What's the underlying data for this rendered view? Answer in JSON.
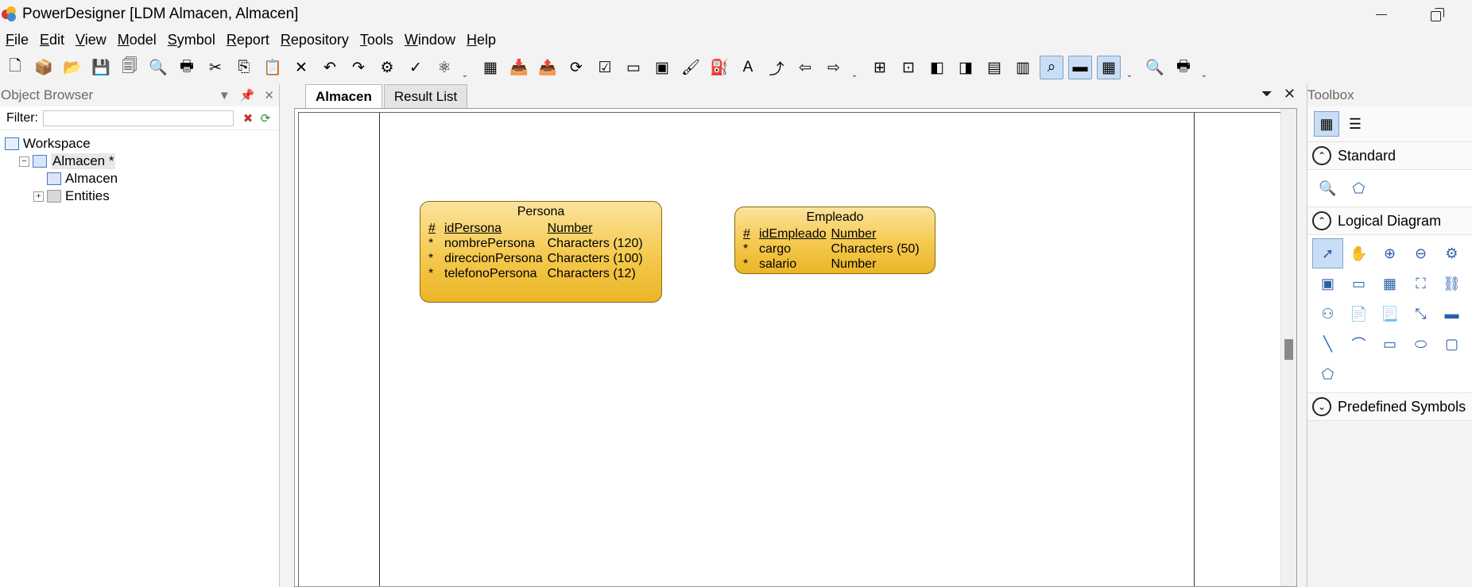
{
  "window": {
    "title": "PowerDesigner [LDM Almacen, Almacen]",
    "minimize": "—",
    "maximize": "❐"
  },
  "menu": [
    {
      "label": "File",
      "key": "F",
      "rest": "ile"
    },
    {
      "label": "Edit",
      "key": "E",
      "rest": "dit"
    },
    {
      "label": "View",
      "key": "V",
      "rest": "iew"
    },
    {
      "label": "Model",
      "key": "M",
      "rest": "odel"
    },
    {
      "label": "Symbol",
      "key": "S",
      "rest": "ymbol"
    },
    {
      "label": "Report",
      "key": "R",
      "rest": "eport"
    },
    {
      "label": "Repository",
      "key": "R",
      "rest": "epository"
    },
    {
      "label": "Tools",
      "key": "T",
      "rest": "ools"
    },
    {
      "label": "Window",
      "key": "W",
      "rest": "indow"
    },
    {
      "label": "Help",
      "key": "H",
      "rest": "elp"
    }
  ],
  "toolbar": {
    "icons": [
      "new-icon",
      "new-project-icon",
      "open-icon",
      "save-icon",
      "save-all-icon",
      "print-preview-icon",
      "print-icon",
      "cut-icon",
      "copy-icon",
      "paste-icon",
      "delete-icon",
      "undo-icon",
      "redo-icon",
      "properties-icon",
      "spell-check-icon",
      "impact-analysis-icon"
    ],
    "icons2": [
      "check-model-icon",
      "import-icon",
      "export-icon",
      "refresh-icon",
      "checklist-icon",
      "shadow-icon",
      "frame-icon",
      "paint-icon",
      "fill-icon",
      "text-color-icon",
      "move-icon",
      "back-icon",
      "forward-icon"
    ],
    "icons3": [
      "align-left-icon",
      "align-center-icon",
      "align-right-icon",
      "distribute-icon",
      "group-icon",
      "ungroup-icon",
      "find-icon",
      "display-icon",
      "grid-icon"
    ],
    "icons4": [
      "zoom-page-icon",
      "print-setup-icon"
    ],
    "glyphs": [
      "🗋",
      "📦",
      "📂",
      "💾",
      "🗐",
      "🔍",
      "🖶",
      "✂",
      "⎘",
      "📋",
      "✕",
      "↶",
      "↷",
      "⚙",
      "✓",
      "⚛"
    ],
    "glyphs2": [
      "▦",
      "📥",
      "📤",
      "⟳",
      "☑",
      "▭",
      "▣",
      "🖌",
      "⛽",
      "A",
      "⤴",
      "⇦",
      "⇨"
    ],
    "glyphs3": [
      "⊞",
      "⊡",
      "◧",
      "◨",
      "▤",
      "▥",
      "⌕",
      "▬",
      "▦"
    ],
    "glyphs4": [
      "🔍",
      "🖶"
    ],
    "more": "⌄"
  },
  "object_browser": {
    "title": "Object Browser",
    "controls": [
      "▼",
      "📌",
      "✕"
    ],
    "filter_label": "Filter:",
    "filter_value": "",
    "filter_icons": [
      "✖",
      "⟳"
    ],
    "tree": [
      {
        "label": "Workspace",
        "level": 0,
        "icon": "workspace-icon",
        "expander": ""
      },
      {
        "label": "Almacen *",
        "level": 1,
        "icon": "model-icon",
        "expander": "−"
      },
      {
        "label": "Almacen",
        "level": 2,
        "icon": "diagram-icon",
        "expander": ""
      },
      {
        "label": "Entities",
        "level": 2,
        "icon": "folder-icon",
        "expander": "+"
      }
    ]
  },
  "document": {
    "tabs": [
      {
        "label": "Almacen",
        "active": true
      },
      {
        "label": "Result List",
        "active": false
      }
    ],
    "controls": [
      "⏷",
      "✕"
    ]
  },
  "entities": [
    {
      "name": "Persona",
      "attributes": [
        {
          "marker": "#",
          "name": "idPersona",
          "type": "Number",
          "identifier": true
        },
        {
          "marker": "*",
          "name": "nombrePersona",
          "type": "Characters (120)",
          "identifier": false
        },
        {
          "marker": "*",
          "name": "direccionPersona",
          "type": "Characters (100)",
          "identifier": false
        },
        {
          "marker": "*",
          "name": "telefonoPersona",
          "type": "Characters (12)",
          "identifier": false
        }
      ]
    },
    {
      "name": "Empleado",
      "attributes": [
        {
          "marker": "#",
          "name": "idEmpleado",
          "type": "Number",
          "identifier": true
        },
        {
          "marker": "*",
          "name": "cargo",
          "type": "Characters (50)",
          "identifier": false
        },
        {
          "marker": "*",
          "name": "salario",
          "type": "Number",
          "identifier": false
        }
      ]
    }
  ],
  "toolbox": {
    "title": "Toolbox",
    "view_icons": [
      "▦",
      "☰"
    ],
    "sections": [
      {
        "label": "Standard",
        "state": "⌃",
        "tools": [
          "🔍",
          "⬠"
        ],
        "tool_names": [
          "find-symbol-icon",
          "free-symbol-icon"
        ]
      },
      {
        "label": "Logical Diagram",
        "state": "⌃",
        "tools": [
          "➚",
          "✋",
          "⊕",
          "⊖",
          "⚙",
          "▣",
          "▭",
          "▦",
          "⛶",
          "⛓",
          "⚇",
          "📄",
          "📃",
          "⤡",
          "▬",
          "╲",
          "⌒",
          "▭",
          "⬭",
          "▢",
          "⬠"
        ],
        "tool_names": [
          "pointer-icon",
          "grabber-icon",
          "zoom-in-icon",
          "zoom-out-icon",
          "open-diagram-icon",
          "package-icon",
          "entity-icon",
          "table-icon",
          "inheritance-icon",
          "relationship-icon",
          "association-icon",
          "file-icon",
          "note-icon",
          "link-icon",
          "title-icon",
          "line-icon",
          "arc-icon",
          "rectangle-icon",
          "ellipse-icon",
          "rounded-rectangle-icon",
          "polygon-icon"
        ]
      },
      {
        "label": "Predefined Symbols",
        "state": "⌄",
        "tools": [],
        "tool_names": []
      }
    ]
  }
}
